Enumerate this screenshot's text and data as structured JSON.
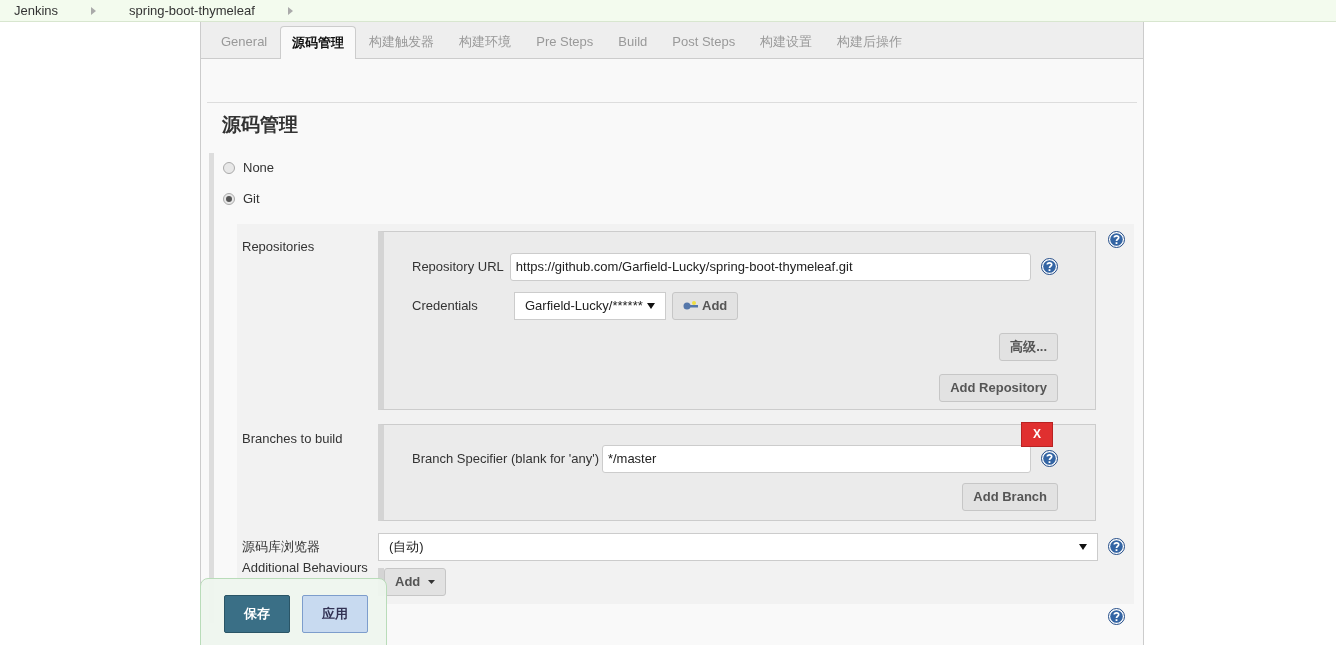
{
  "breadcrumbs": [
    "Jenkins",
    "spring-boot-thymeleaf"
  ],
  "tabs": [
    {
      "label": "General",
      "selected": false
    },
    {
      "label": "源码管理",
      "selected": true
    },
    {
      "label": "构建触发器",
      "selected": false
    },
    {
      "label": "构建环境",
      "selected": false
    },
    {
      "label": "Pre Steps",
      "selected": false
    },
    {
      "label": "Build",
      "selected": false
    },
    {
      "label": "Post Steps",
      "selected": false
    },
    {
      "label": "构建设置",
      "selected": false
    },
    {
      "label": "构建后操作",
      "selected": false
    }
  ],
  "section_title": "源码管理",
  "scm_options": [
    {
      "label": "None",
      "selected": false
    },
    {
      "label": "Git",
      "selected": true
    }
  ],
  "repositories": {
    "label": "Repositories",
    "url_label": "Repository URL",
    "url": "https://github.com/Garfield-Lucky/spring-boot-thymeleaf.git",
    "credentials_label": "Credentials",
    "credentials": "Garfield-Lucky/******",
    "add_button": "Add",
    "advanced_button": "高级...",
    "add_repository_button": "Add Repository"
  },
  "branches": {
    "label": "Branches to build",
    "specifier_label": "Branch Specifier (blank for 'any')",
    "specifier": "*/master",
    "delete_button": "X",
    "add_branch_button": "Add Branch"
  },
  "browser": {
    "label": "源码库浏览器",
    "value": "(自动)"
  },
  "additional": {
    "label": "Additional Behaviours",
    "add_button": "Add"
  },
  "save_bar": {
    "save": "保存",
    "apply": "应用"
  }
}
